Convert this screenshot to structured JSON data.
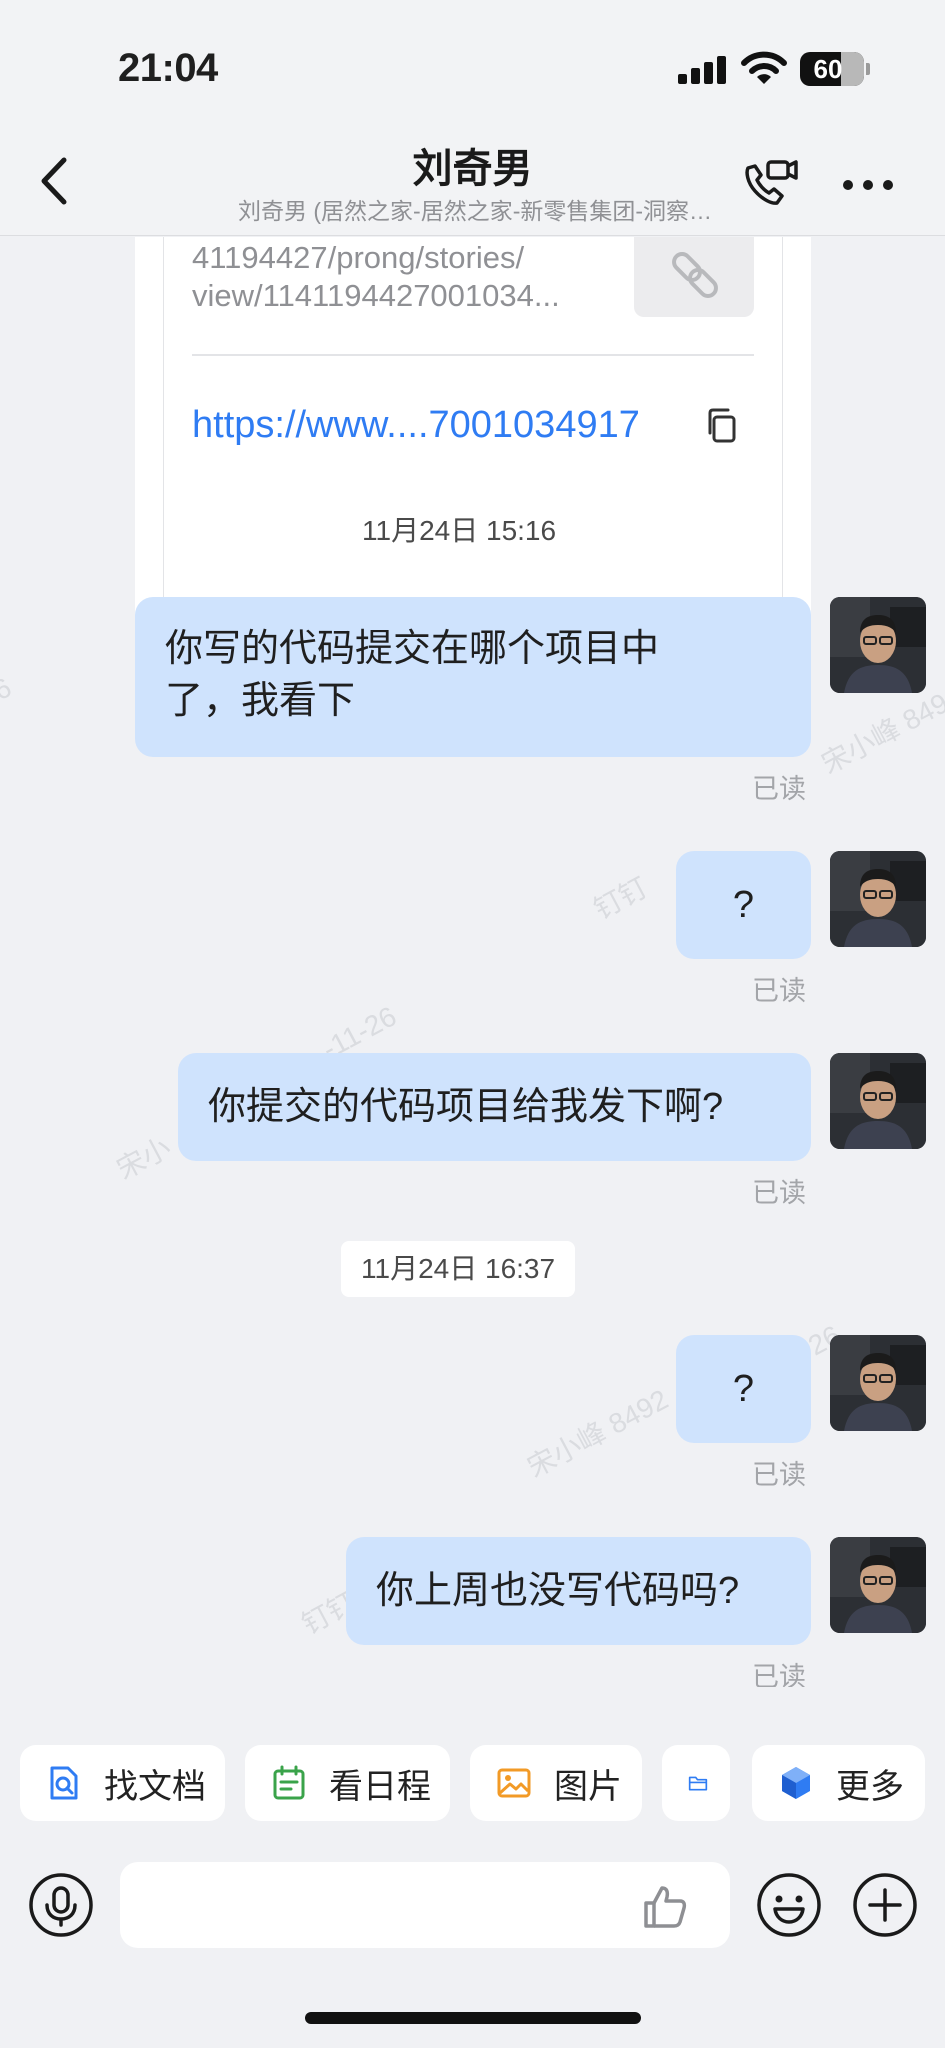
{
  "status": {
    "time": "21:04",
    "battery": "60"
  },
  "nav": {
    "title": "刘奇男",
    "subtitle": "刘奇男 (居然之家-居然之家-新零售集团-洞察中心)",
    "back_icon": "chevron-left-icon",
    "call_icon": "video-call-icon",
    "more_icon": "more-dots-icon"
  },
  "link_card": {
    "path": "41194427/prong/stories/\nview/1141194427001034...",
    "url": "https://www....7001034917"
  },
  "messages": [
    {
      "type": "time",
      "text": "11月24日 15:16"
    },
    {
      "type": "text",
      "text": "你写的代码提交在哪个项目中\n了，我看下",
      "status": "已读"
    },
    {
      "type": "text",
      "text": "?",
      "status": "已读"
    },
    {
      "type": "text",
      "text": "你提交的代码项目给我发下啊?",
      "status": "已读"
    },
    {
      "type": "time",
      "text": "11月24日 16:37"
    },
    {
      "type": "text",
      "text": "?",
      "status": "已读"
    },
    {
      "type": "text",
      "text": "你上周也没写代码吗?",
      "status": "已读"
    }
  ],
  "watermarks": [
    "钉钉",
    "宋小峰 849",
    "钉钉",
    "-11-26",
    "宋小",
    "-26",
    "宋小峰 8492",
    "钉钉",
    "26"
  ],
  "quick_actions": [
    {
      "label": "找文档",
      "icon": "find-doc-icon",
      "color": "#2f7cf3"
    },
    {
      "label": "看日程",
      "icon": "calendar-icon",
      "color": "#3aa34a"
    },
    {
      "label": "图片",
      "icon": "image-icon",
      "color": "#f29a26"
    },
    {
      "label": "",
      "icon": "folder-icon",
      "color": "#2f7cf3"
    },
    {
      "label": "更多",
      "icon": "more-apps-icon",
      "color": "#2f7cf3"
    }
  ],
  "input": {
    "placeholder": ""
  }
}
